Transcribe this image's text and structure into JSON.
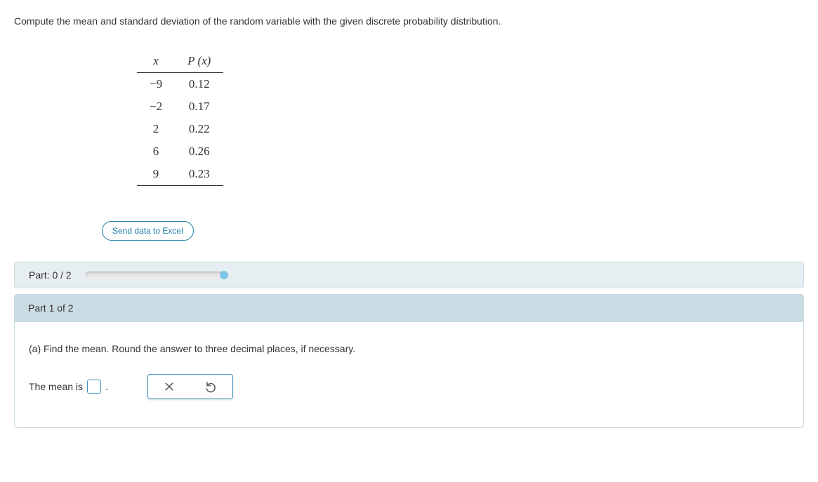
{
  "prompt": "Compute the mean and standard deviation of the random variable with the given discrete probability distribution.",
  "table": {
    "headers": {
      "x": "x",
      "px": "P (x)"
    },
    "rows": [
      {
        "x": "−9",
        "p": "0.12"
      },
      {
        "x": "−2",
        "p": "0.17"
      },
      {
        "x": "2",
        "p": "0.22"
      },
      {
        "x": "6",
        "p": "0.26"
      },
      {
        "x": "9",
        "p": "0.23"
      }
    ]
  },
  "excel_button": "Send data to Excel",
  "progress": {
    "label": "Part: 0 / 2"
  },
  "part": {
    "header": "Part 1 of 2",
    "question": "(a) Find the mean. Round the answer to three decimal places, if necessary.",
    "answer_prefix": "The mean is",
    "answer_suffix": ".",
    "input_value": ""
  },
  "icons": {
    "clear": "close-icon",
    "reset": "undo-icon"
  }
}
